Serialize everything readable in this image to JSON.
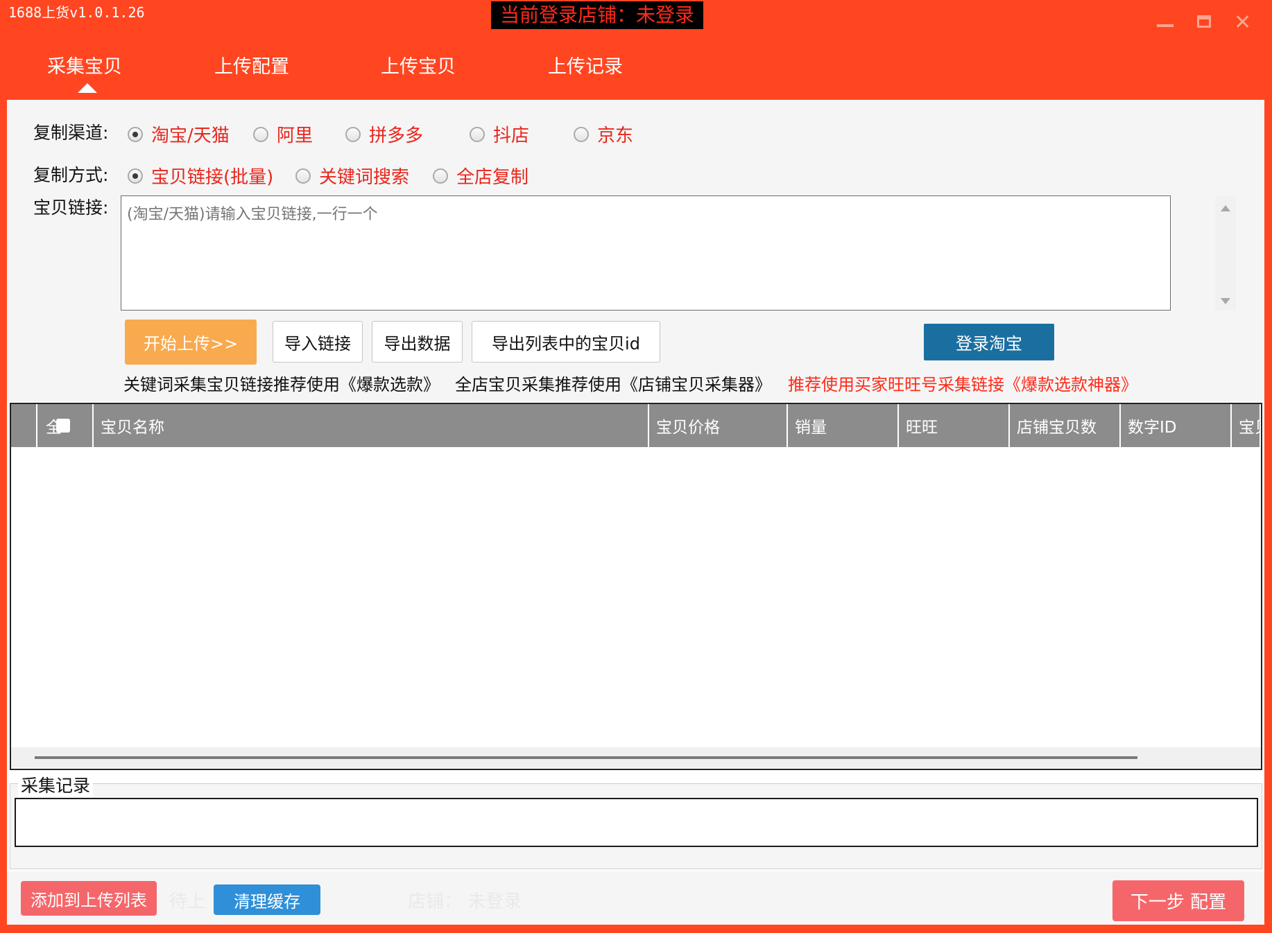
{
  "app": {
    "title": "1688上货v1.0.1.26",
    "store_banner": "当前登录店铺：未登录"
  },
  "tabs": [
    {
      "label": "采集宝贝",
      "active": true
    },
    {
      "label": "上传配置"
    },
    {
      "label": "上传宝贝"
    },
    {
      "label": "上传记录"
    }
  ],
  "form": {
    "channel_label": "复制渠道:",
    "channels": [
      {
        "label": "淘宝/天猫",
        "checked": true
      },
      {
        "label": "阿里"
      },
      {
        "label": "拼多多"
      },
      {
        "label": "抖店"
      },
      {
        "label": "京东"
      }
    ],
    "method_label": "复制方式:",
    "methods": [
      {
        "label": "宝贝链接(批量)",
        "checked": true
      },
      {
        "label": "关键词搜索"
      },
      {
        "label": "全店复制"
      }
    ],
    "link_label": "宝贝链接:",
    "link_placeholder": "(淘宝/天猫)请输入宝贝链接,一行一个"
  },
  "buttons": {
    "start_upload": "开始上传>>",
    "import_links": "导入链接",
    "export_data": "导出数据",
    "export_ids": "导出列表中的宝贝id",
    "login_taobao": "登录淘宝"
  },
  "tips": {
    "tip1": "关键词采集宝贝链接推荐使用《爆款选款》",
    "tip2": "全店宝贝采集推荐使用《店铺宝贝采集器》",
    "tip3": "推荐使用买家旺旺号采集链接《爆款选款神器》"
  },
  "table": {
    "select_all": "全",
    "columns": [
      "宝贝名称",
      "宝贝价格",
      "销量",
      "旺旺",
      "店铺宝贝数",
      "数字ID",
      "宝贝"
    ]
  },
  "log": {
    "legend": "采集记录"
  },
  "bottom": {
    "add_to_upload": "添加到上传列表",
    "pending": "待上",
    "clear_cache": "清理缓存",
    "store_status": "店铺：  未登录",
    "next_step": "下一步  配置"
  },
  "colors": {
    "brand": "#ff4621",
    "accent_red": "#e8261c",
    "start_button": "#f9a94e",
    "login_button": "#1b6fa0",
    "clear_button": "#2f8fd8",
    "pink_button": "#f5666a",
    "table_header": "#8c8c8c"
  }
}
